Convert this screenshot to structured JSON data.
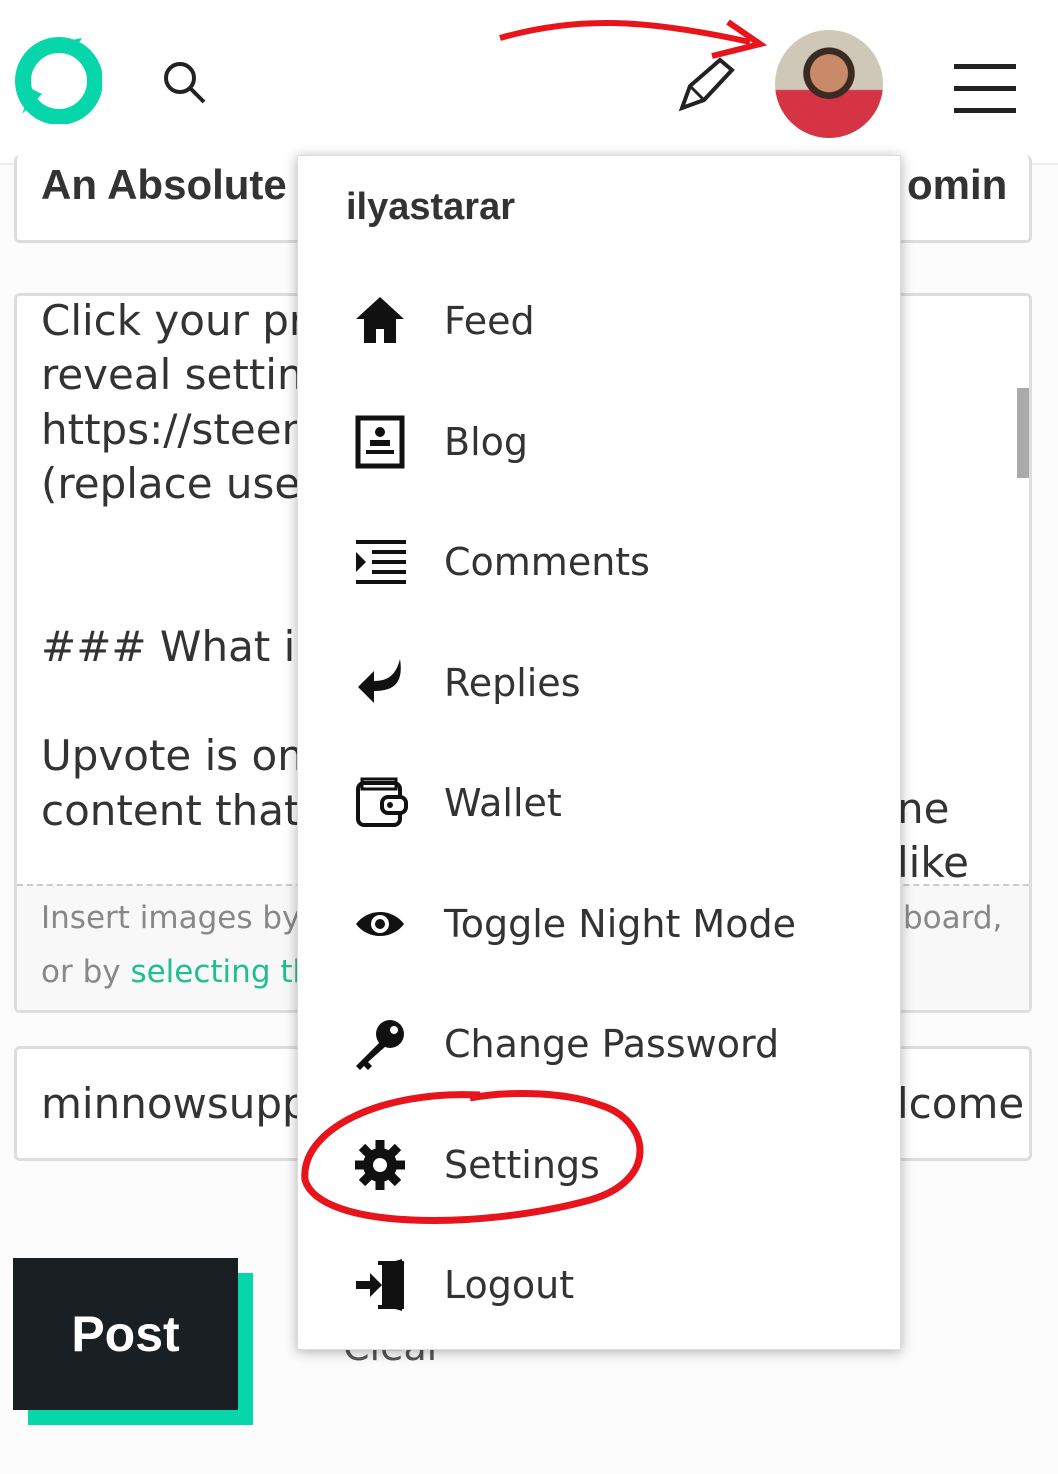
{
  "header": {
    "icons": [
      "steemit-logo",
      "search-icon",
      "pen-icon",
      "avatar",
      "hamburger-menu-icon"
    ]
  },
  "editor": {
    "title_left": "An Absolute",
    "title_right": "omin",
    "body_lines_left": [
      "Click your pr",
      "reveal setting",
      "https://steem",
      "(replace user",
      "",
      "",
      "### What is U",
      "",
      "Upvote is one",
      "content that"
    ],
    "body_lines_right": [
      "ne",
      "like"
    ],
    "drop_left1": "Insert images by c",
    "drop_left2_pre": "or by ",
    "drop_left2_link": "selecting the",
    "drop_right": "board,",
    "tags_left": "minnowsupp",
    "tags_right": "lcome"
  },
  "post_label": "Post",
  "clear_label": "Clear",
  "dropdown": {
    "username": "ilyastarar",
    "items": [
      {
        "label": "Feed",
        "icon": "home-icon"
      },
      {
        "label": "Blog",
        "icon": "blog-icon"
      },
      {
        "label": "Comments",
        "icon": "comments-icon"
      },
      {
        "label": "Replies",
        "icon": "reply-icon"
      },
      {
        "label": "Wallet",
        "icon": "wallet-icon"
      },
      {
        "label": "Toggle Night Mode",
        "icon": "eye-icon"
      },
      {
        "label": "Change Password",
        "icon": "key-icon"
      },
      {
        "label": "Settings",
        "icon": "gear-icon"
      },
      {
        "label": "Logout",
        "icon": "logout-icon"
      }
    ]
  },
  "colors": {
    "accent": "#06d6a9",
    "annotation": "#e8141c",
    "dark": "#1a1f24"
  }
}
